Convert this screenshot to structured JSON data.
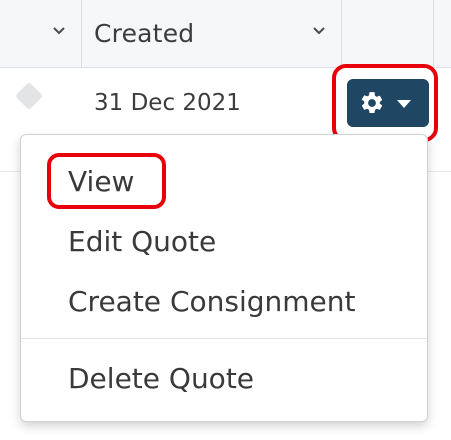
{
  "grid": {
    "columns": [
      {
        "label": ""
      },
      {
        "label": "Created"
      },
      {
        "label": ""
      },
      {
        "label": ""
      }
    ],
    "row": {
      "created": "31 Dec 2021"
    }
  },
  "actions_button": {
    "icon": "gear-icon",
    "caret_icon": "caret-down-icon",
    "color": "#1f4663"
  },
  "menu": {
    "items": [
      {
        "label": "View"
      },
      {
        "label": "Edit Quote"
      },
      {
        "label": "Create Consignment"
      },
      {
        "label": "Delete Quote"
      }
    ]
  },
  "highlight_color": "#e8000b"
}
